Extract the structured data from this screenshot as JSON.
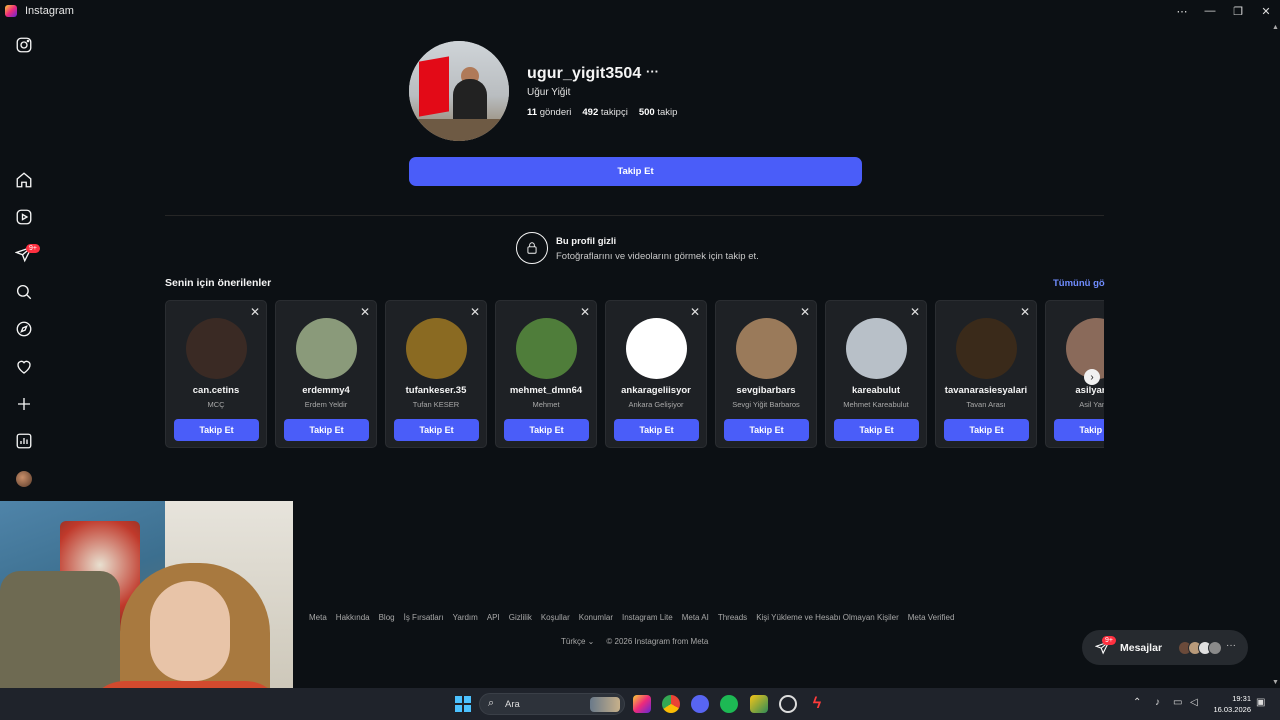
{
  "window": {
    "title": "Instagram",
    "controls": [
      "⋯",
      "—",
      "❐",
      "✕"
    ]
  },
  "sidebar": {
    "items": [
      {
        "name": "instagram-logo-icon",
        "icon": "instagram-glyph"
      },
      {
        "name": "home-icon",
        "icon": "home"
      },
      {
        "name": "reels-icon",
        "icon": "reels"
      },
      {
        "name": "messages-icon",
        "icon": "paper-plane"
      },
      {
        "name": "search-icon",
        "icon": "search"
      },
      {
        "name": "explore-icon",
        "icon": "compass"
      },
      {
        "name": "notifications-icon",
        "icon": "heart"
      },
      {
        "name": "create-icon",
        "icon": "plus"
      },
      {
        "name": "dashboard-icon",
        "icon": "chart"
      }
    ],
    "messages_badge": "9+"
  },
  "profile": {
    "username": "ugur_yigit3504",
    "full_name": "Uğur Yiğit",
    "posts_count": "11",
    "posts_label": "gönderi",
    "followers_count": "492",
    "followers_label": "takipçi",
    "following_count": "500",
    "following_label": "takip",
    "follow_button": "Takip Et"
  },
  "private_notice": {
    "title": "Bu profil gizli",
    "subtitle": "Fotoğraflarını ve videolarını görmek için takip et."
  },
  "suggestions": {
    "title": "Senin için önerilenler",
    "see_all": "Tümünü gör",
    "follow_label": "Takip Et",
    "cards": [
      {
        "username": "can.cetins",
        "name": "MCÇ",
        "avatar_color": "#3a2a24"
      },
      {
        "username": "erdemmy4",
        "name": "Erdem Yeldir",
        "avatar_color": "#8a9a7a"
      },
      {
        "username": "tufankeser.35",
        "name": "Tufan KESER",
        "avatar_color": "#8a6a22"
      },
      {
        "username": "mehmet_dmn64",
        "name": "Mehmet",
        "avatar_color": "#4f7d3a"
      },
      {
        "username": "ankarageliisyor",
        "name": "Ankara Gelişiyor",
        "avatar_color": "#ffffff"
      },
      {
        "username": "sevgibarbars",
        "name": "Sevgi Yiğit Barbaros",
        "avatar_color": "#9a7a5a"
      },
      {
        "username": "kareabulut",
        "name": "Mehmet Kareabulut",
        "avatar_color": "#b8c0c8"
      },
      {
        "username": "tavanarasiesyalari",
        "name": "Tavan Arası",
        "avatar_color": "#3a2a1a"
      },
      {
        "username": "asilyanar",
        "name": "Asil Yanar",
        "avatar_color": "#8a6a5a"
      }
    ]
  },
  "footer": {
    "links": [
      "Meta",
      "Hakkında",
      "Blog",
      "İş Fırsatları",
      "Yardım",
      "API",
      "Gizlilik",
      "Koşullar",
      "Konumlar",
      "Instagram Lite",
      "Meta AI",
      "Threads",
      "Kişi Yükleme ve Hesabı Olmayan Kişiler",
      "Meta Verified"
    ],
    "language": "Türkçe ⌄",
    "copyright": "© 2026 Instagram from Meta"
  },
  "messages_pill": {
    "label": "Mesajlar",
    "badge": "9+"
  },
  "taskbar": {
    "search_placeholder": "Ara",
    "time": "19:31",
    "date": "16.03.2026"
  }
}
